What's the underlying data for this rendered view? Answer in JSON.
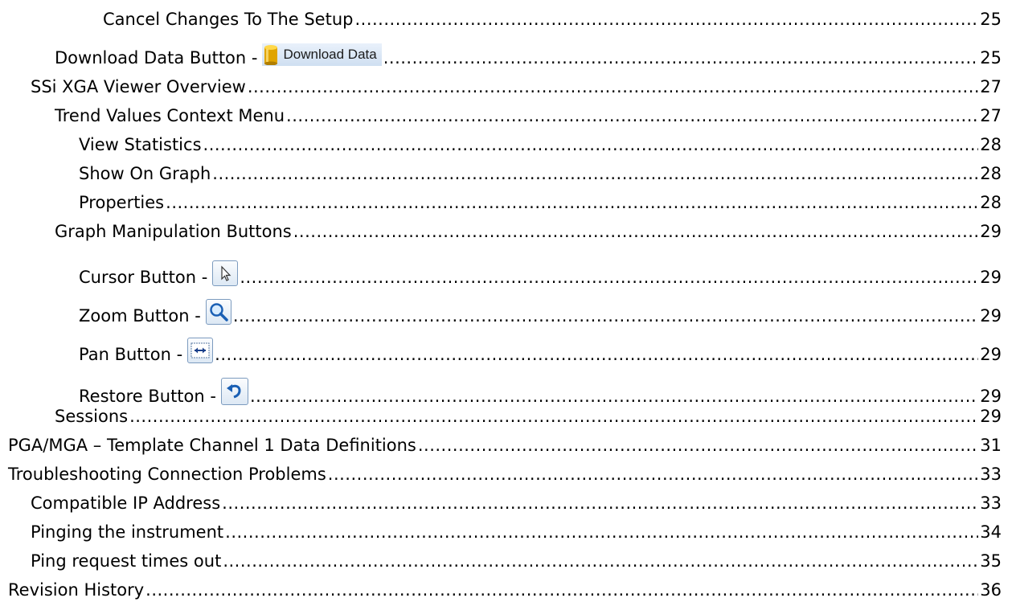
{
  "toc": [
    {
      "title": "Cancel Changes To The Setup",
      "page": "25"
    },
    {
      "title": "Download Data Button -",
      "page": "25",
      "button_label": "Download Data"
    },
    {
      "title": "SSi XGA Viewer Overview",
      "page": "27"
    },
    {
      "title": "Trend Values Context Menu",
      "page": "27"
    },
    {
      "title": "View Statistics",
      "page": "28"
    },
    {
      "title": "Show On Graph",
      "page": "28"
    },
    {
      "title": "Properties",
      "page": "28"
    },
    {
      "title": "Graph Manipulation Buttons",
      "page": "29"
    },
    {
      "title": "Cursor Button -",
      "page": "29"
    },
    {
      "title": "Zoom Button -",
      "page": "29"
    },
    {
      "title": "Pan Button -",
      "page": "29"
    },
    {
      "title": "Restore Button -",
      "page": "29"
    },
    {
      "title": "Sessions",
      "page": "29"
    },
    {
      "title": "PGA/MGA – Template Channel 1 Data Definitions",
      "page": "31"
    },
    {
      "title": "Troubleshooting Connection Problems",
      "page": "33"
    },
    {
      "title": "Compatible IP Address",
      "page": "33"
    },
    {
      "title": "Pinging the instrument",
      "page": "34"
    },
    {
      "title": "Ping request times out",
      "page": "35"
    },
    {
      "title": "Revision History",
      "page": "36"
    }
  ],
  "icons": {
    "download": "database-icon",
    "cursor": "cursor-arrow-icon",
    "zoom": "magnifier-icon",
    "pan": "pan-arrows-icon",
    "restore": "undo-arrow-icon"
  },
  "colors": {
    "text": "#000000",
    "button_border": "#7c9bbf",
    "icon_blue": "#1a5fb4",
    "database_gold": "#e0a400"
  }
}
